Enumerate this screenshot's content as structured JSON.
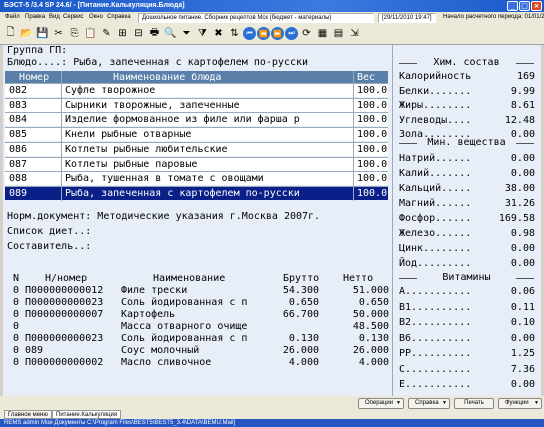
{
  "window": {
    "title": "БЭСТ-5 /3.4 SP 24.6/ - [Питание.Калькуляция.Блюда]"
  },
  "menu": {
    "items": [
      "Файл",
      "Правка",
      "Вид",
      "Сервис",
      "Окно",
      "Справка"
    ],
    "module": "Дошкольное питание. Сборник рецептов Мск (бюджет - материалы)",
    "date": "[29/11/2010 19:47]",
    "period": "Начало расчетного периода: 01/01/2008"
  },
  "header": {
    "group_line": "Группа ГП:",
    "dish_line": "Блюдо....: Рыба, запеченная с картофелем по-русски"
  },
  "grid": {
    "columns": [
      "Номер",
      "Наименование блюда",
      "Вес"
    ],
    "rows": [
      [
        "082",
        "Суфле творожное",
        "100.0"
      ],
      [
        "083",
        "Сырники творожные, запеченные",
        "100.0"
      ],
      [
        "084",
        "Изделие формованное из филе или фарша р",
        "100.0"
      ],
      [
        "085",
        "Кнели рыбные отварные",
        "100.0"
      ],
      [
        "086",
        "Котлеты рыбные любительские",
        "100.0"
      ],
      [
        "087",
        "Котлеты рыбные паровые",
        "100.0"
      ],
      [
        "088",
        "Рыба, тушенная в томате с овощами",
        "100.0"
      ],
      [
        "089",
        "Рыба, запеченная с картофелем по-русски",
        "100.0"
      ]
    ],
    "selected_index": 7
  },
  "info": {
    "norm_doc": "Норм.документ: Методические указания г.Москва 2007г.",
    "diet_list": "Список диет..:",
    "author": "Составитель..:"
  },
  "ingredients": {
    "columns": [
      "N",
      "Н/номер",
      "Наименование",
      "Брутто",
      "Нетто"
    ],
    "rows": [
      [
        "0",
        "П000000000012",
        "Филе трески",
        "54.300",
        "51.000"
      ],
      [
        "0",
        "П000000000023",
        "Соль йодированная с п",
        "0.650",
        "0.650"
      ],
      [
        "0",
        "П000000000007",
        "Картофель",
        "66.700",
        "50.000"
      ],
      [
        "0",
        "",
        "Масса отварного очище",
        "",
        "48.500"
      ],
      [
        "0",
        "П000000000023",
        "Соль йодированная с п",
        "0.130",
        "0.130"
      ],
      [
        "0",
        "089",
        "Соус молочный",
        "26.000",
        "26.000"
      ],
      [
        "0",
        "П000000000002",
        "Масло сливочное",
        "4.000",
        "4.000"
      ]
    ]
  },
  "chem": {
    "title": "Хим. состав",
    "rows": [
      [
        "Калорийность",
        "169"
      ],
      [
        "Белки.......",
        "9.99"
      ],
      [
        "Жиры........",
        "8.61"
      ],
      [
        "Углеводы....",
        "12.48"
      ],
      [
        "Зола........",
        "0.00"
      ]
    ]
  },
  "minerals": {
    "title": "Мин. вещества",
    "rows": [
      [
        "Натрий......",
        "0.00"
      ],
      [
        "Калий.......",
        "0.00"
      ],
      [
        "Кальций.....",
        "38.00"
      ],
      [
        "Магний......",
        "31.26"
      ],
      [
        "Фосфор......",
        "169.58"
      ],
      [
        "Железо......",
        "0.98"
      ],
      [
        "Цинк........",
        "0.00"
      ],
      [
        "Йод.........",
        "0.00"
      ]
    ]
  },
  "vitamins": {
    "title": "Витамины",
    "rows": [
      [
        "А...........",
        "0.06"
      ],
      [
        "В1..........",
        "0.11"
      ],
      [
        "В2..........",
        "0.10"
      ],
      [
        "В6..........",
        "0.00"
      ],
      [
        "РР..........",
        "1.25"
      ],
      [
        "С...........",
        "7.36"
      ],
      [
        "Е...........",
        "0.00"
      ]
    ]
  },
  "bottom": {
    "operations": "Операции",
    "help": "Справка",
    "print": "Печать",
    "functions": "Функции"
  },
  "tabs": [
    "Главное меню",
    "Питание.Калькуляция"
  ],
  "taskbar": {
    "text": "REMS  admin  Мои Документы C:\\Program Files\\BEST5\\BEST5_3.4\\DATA\\BEMU.Mail]"
  }
}
